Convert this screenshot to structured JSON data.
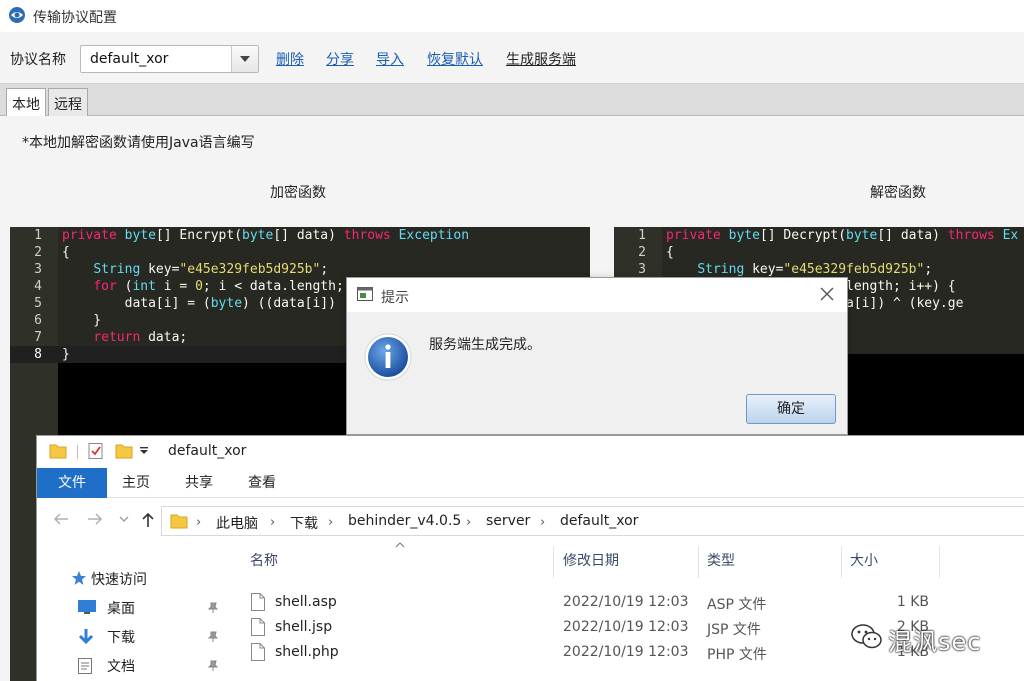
{
  "config_window": {
    "title": "传输协议配置",
    "toolbar": {
      "protocol_label": "协议名称",
      "protocol_value": "default_xor",
      "delete": "删除",
      "share": "分享",
      "import": "导入",
      "restore_default": "恢复默认",
      "generate_server": "生成服务端"
    },
    "tabs": [
      {
        "label": "本地",
        "active": true
      },
      {
        "label": "远程",
        "active": false
      }
    ],
    "note": "*本地加解密函数请使用Java语言编写",
    "encrypt_title": "加密函数",
    "decrypt_title": "解密函数",
    "encrypt_code": [
      "private byte[] Encrypt(byte[] data) throws Exception",
      "{",
      "    String key=\"e45e329feb5d925b\";",
      "    for (int i = 0; i < data.length;",
      "        data[i] = (byte) ((data[i])",
      "    }",
      "    return data;",
      "}"
    ],
    "decrypt_code": [
      "private byte[] Decrypt(byte[] data) throws Ex",
      "{",
      "    String key=\"e45e329feb5d925b\";",
      "                  data.length; i++) {",
      "                ) ((data[i]) ^ (key.ge"
    ],
    "decrypt_line_numbers": [
      "1",
      "2",
      "3"
    ]
  },
  "dialog": {
    "title": "提示",
    "message": "服务端生成完成。",
    "ok": "确定"
  },
  "explorer": {
    "title": "default_xor",
    "ribbon_tabs": [
      "文件",
      "主页",
      "共享",
      "查看"
    ],
    "breadcrumb": [
      "此电脑",
      "下载",
      "behinder_v4.0.5",
      "server",
      "default_xor"
    ],
    "nav": [
      {
        "label": "快速访问",
        "icon": "star-icon"
      },
      {
        "label": "桌面",
        "icon": "desktop-icon"
      },
      {
        "label": "下载",
        "icon": "download-icon"
      },
      {
        "label": "文档",
        "icon": "document-icon"
      }
    ],
    "columns": {
      "name": "名称",
      "date": "修改日期",
      "type": "类型",
      "size": "大小"
    },
    "files": [
      {
        "name": "shell.asp",
        "date": "2022/10/19 12:03",
        "type": "ASP 文件",
        "size": "1 KB"
      },
      {
        "name": "shell.jsp",
        "date": "2022/10/19 12:03",
        "type": "JSP 文件",
        "size": "2 KB"
      },
      {
        "name": "shell.php",
        "date": "2022/10/19 12:03",
        "type": "PHP 文件",
        "size": "1 KB"
      }
    ]
  },
  "watermark": "混沨sec",
  "colors": {
    "editor_bg": "#272822",
    "keyword": "#f92672",
    "type": "#66d9ef",
    "string": "#e6db74",
    "link": "#1a5fb4",
    "ribbon_file": "#1f6fc8"
  }
}
